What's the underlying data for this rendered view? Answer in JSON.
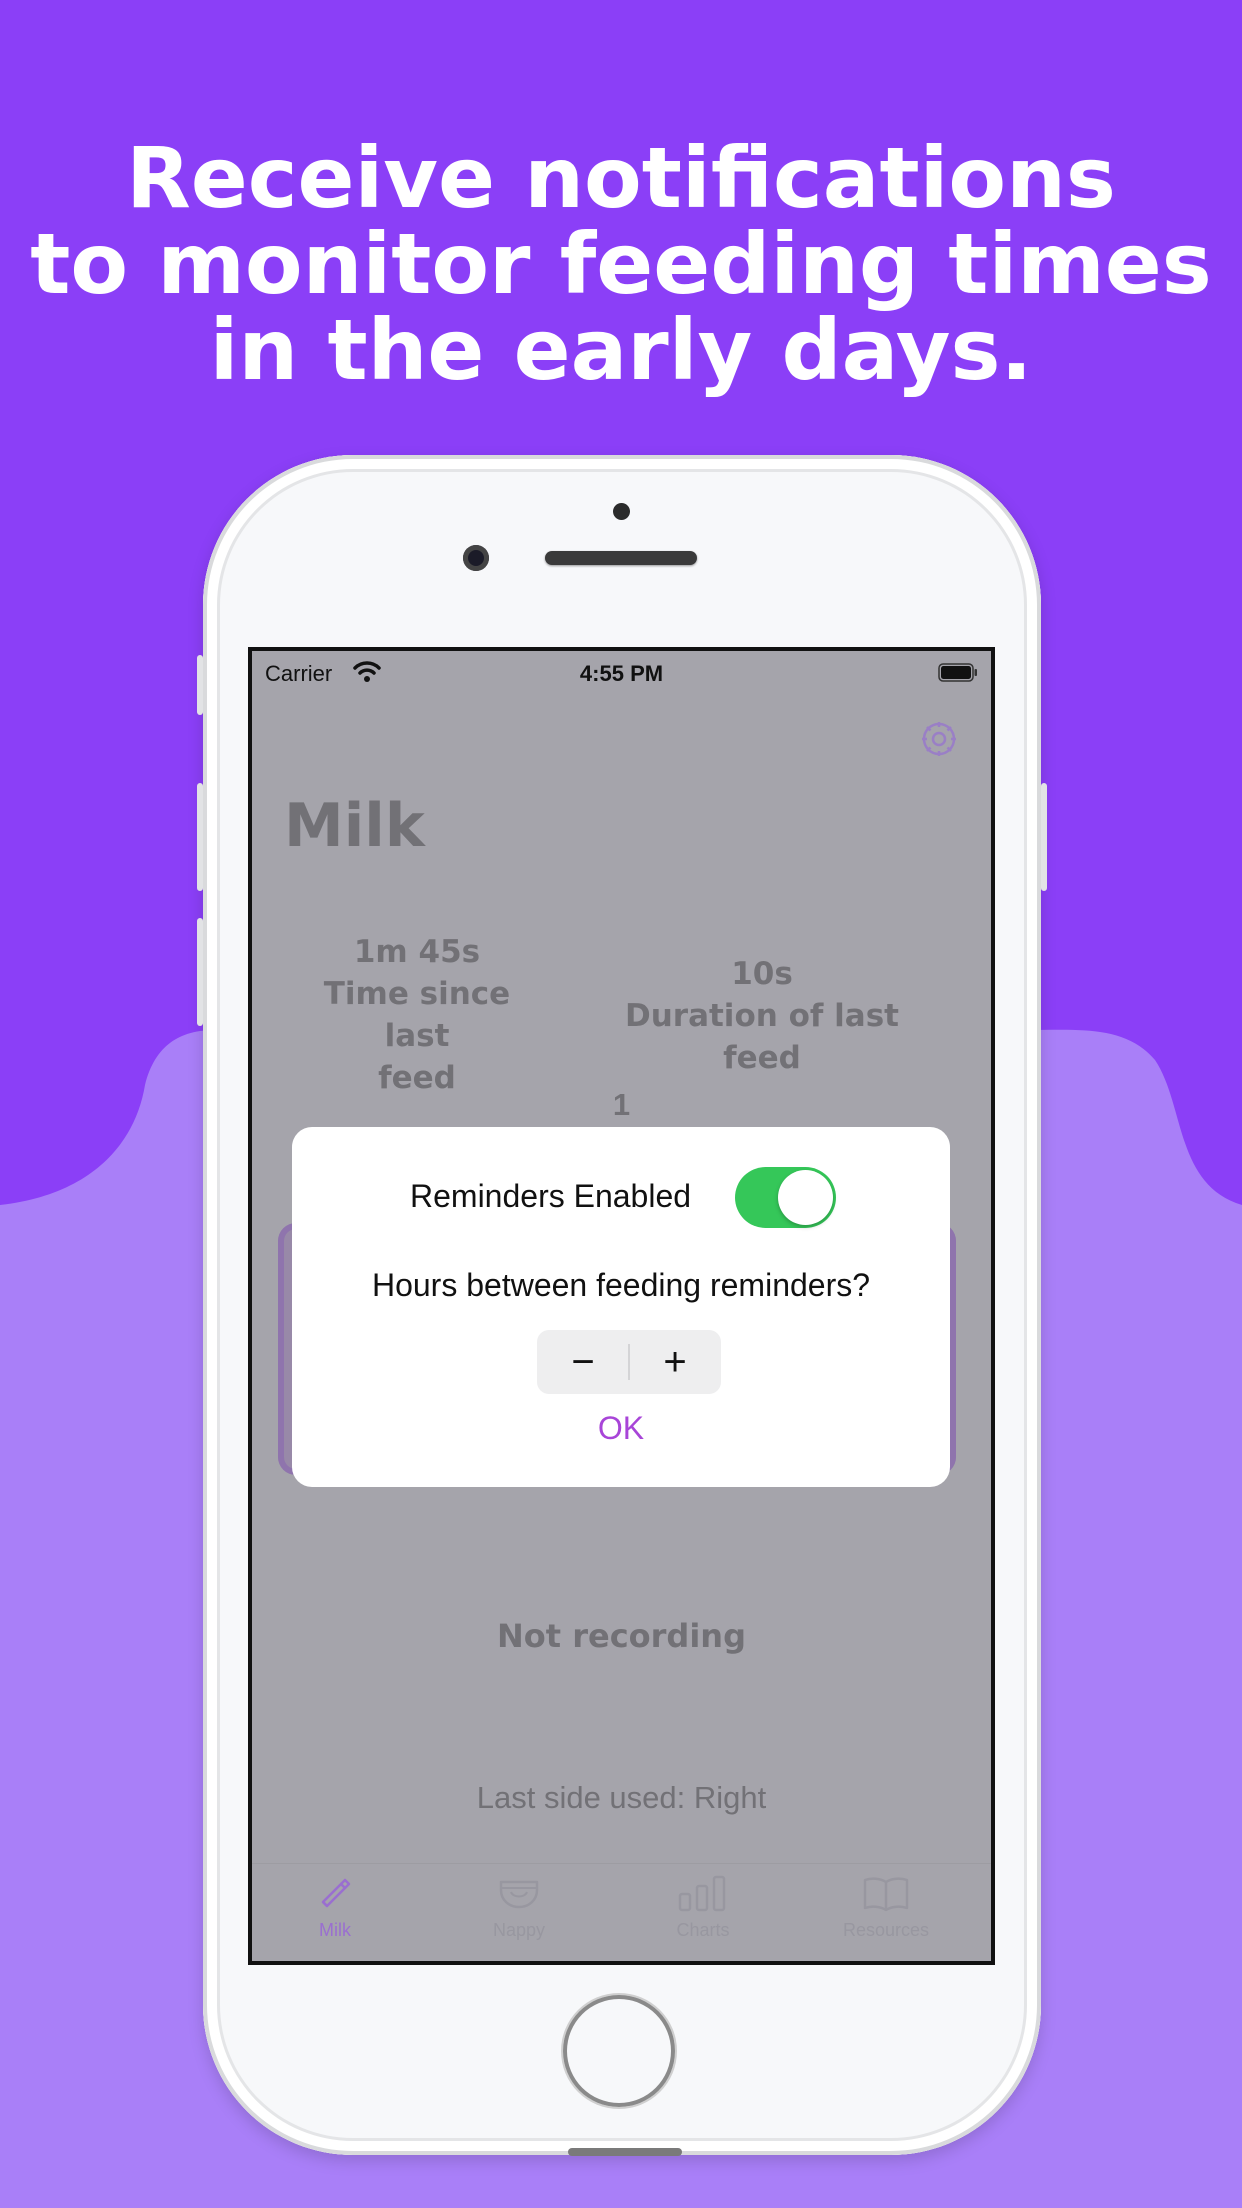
{
  "headline": [
    "Receive notifications",
    "to monitor feeding times",
    "in the early days."
  ],
  "status_bar": {
    "carrier": "Carrier",
    "time": "4:55 PM"
  },
  "screen": {
    "title": "Milk",
    "time_since_value": "1m 45s",
    "time_since_label": [
      "Time since last",
      "feed"
    ],
    "duration_value": "10s",
    "duration_label": "Duration of last feed",
    "count": "1",
    "status": "Not recording",
    "last_side": "Last side used: Right"
  },
  "modal": {
    "reminders_label": "Reminders Enabled",
    "reminders_enabled": true,
    "hours_question": "Hours between feeding reminders?",
    "minus": "−",
    "plus": "+",
    "ok": "OK"
  },
  "tabs": [
    {
      "label": "Milk",
      "icon": "bottle-icon",
      "active": true
    },
    {
      "label": "Nappy",
      "icon": "nappy-icon",
      "active": false
    },
    {
      "label": "Charts",
      "icon": "bar-chart-icon",
      "active": false
    },
    {
      "label": "Resources",
      "icon": "book-icon",
      "active": false
    }
  ],
  "colors": {
    "background": "#8b3ff7",
    "wave": "#a97ff8",
    "toggle_on": "#35c759",
    "ok_accent": "#a845d8",
    "dim_overlay": "#a5a4ab"
  }
}
